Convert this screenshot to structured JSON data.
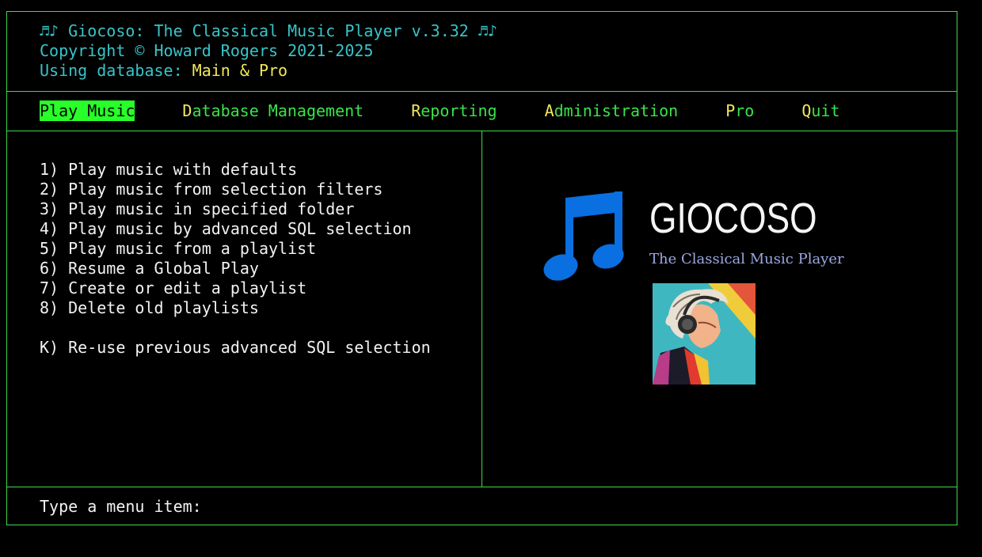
{
  "header": {
    "title_line": "♬♪ Giocoso: The Classical Music Player v.3.32 ♬♪",
    "copyright": "Copyright © Howard Rogers 2021-2025",
    "db_label": "Using database: ",
    "db_value": "Main & Pro"
  },
  "menu": [
    {
      "hot": "P",
      "rest": "lay Music",
      "active": true
    },
    {
      "hot": "D",
      "rest": "atabase Management",
      "active": false
    },
    {
      "hot": "R",
      "rest": "eporting",
      "active": false
    },
    {
      "hot": "A",
      "rest": "dministration",
      "active": false
    },
    {
      "hot": "P",
      "rest": "ro",
      "active": false
    },
    {
      "hot": "Q",
      "rest": "uit",
      "active": false
    }
  ],
  "options": [
    "1) Play music with defaults",
    "2) Play music from selection filters",
    "3) Play music in specified folder",
    "4) Play music by advanced SQL selection",
    "5) Play music from a playlist",
    "6) Resume a Global Play",
    "7) Create or edit a playlist",
    "8) Delete old playlists"
  ],
  "extra_option": "K) Re-use previous advanced SQL selection",
  "prompt": "Type a menu item:",
  "branding": {
    "logo_text": "GIOCOSO",
    "tagline": "The Classical Music Player",
    "note_icon": "music-note-icon",
    "portrait": "beethoven-headphones-portrait"
  },
  "colors": {
    "border": "#3fd84a",
    "menu_text": "#39e34a",
    "hotkey": "#f1e95a",
    "active_bg": "#28ff2a",
    "header_teal": "#38c4c8",
    "note_blue": "#0a6fe0",
    "tagline": "#9aa9e0"
  }
}
